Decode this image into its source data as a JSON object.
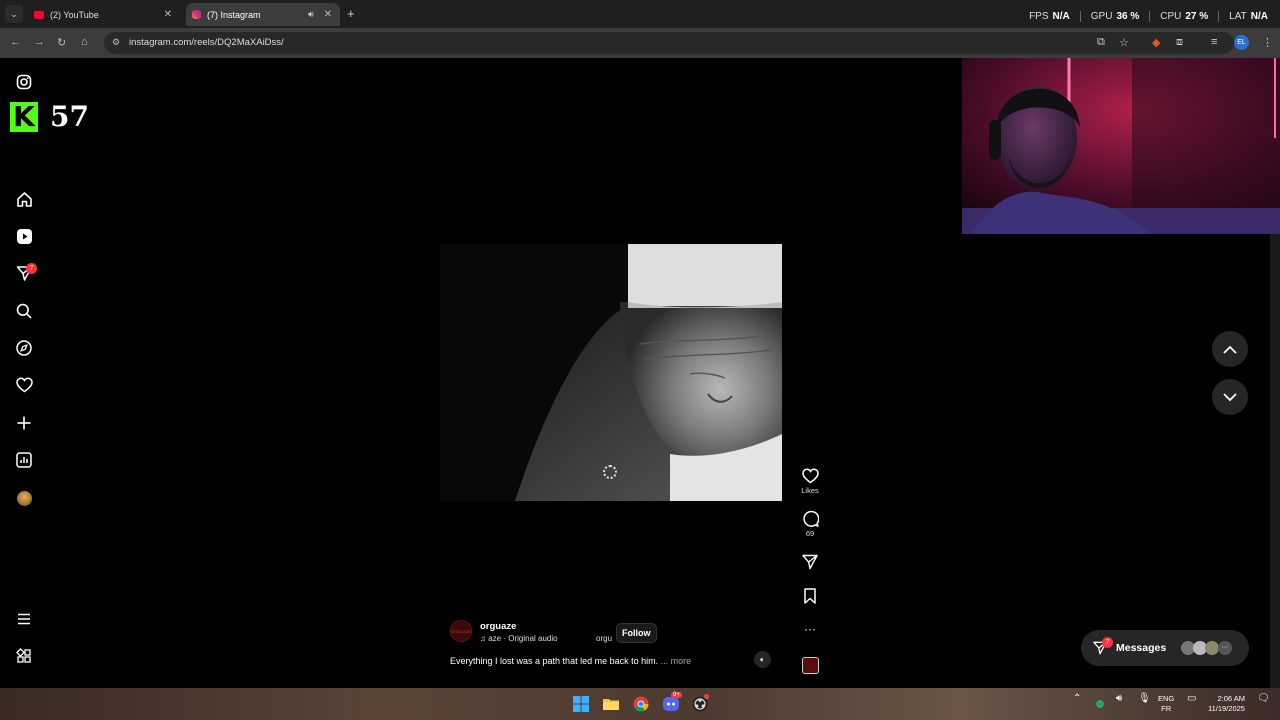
{
  "browser": {
    "tabs": [
      {
        "label": "(2) YouTube",
        "active": false,
        "favicon_color": "#ff0033"
      },
      {
        "label": "(7) Instagram",
        "active": true,
        "favicon_color": "#e1306c"
      }
    ],
    "url": "instagram.com/reels/DQ2MaXAiDss/",
    "profile_initials": "EL"
  },
  "perf_overlay": {
    "fps_label": "FPS",
    "fps_value": "N/A",
    "gpu_label": "GPU",
    "gpu_value": "36 %",
    "cpu_label": "CPU",
    "cpu_value": "27 %",
    "lat_label": "LAT",
    "lat_value": "N/A"
  },
  "sidebar": {
    "overlay_number": "57",
    "notifications_badge": "7"
  },
  "reel": {
    "username": "orguaze",
    "audio": "aze · Original audio",
    "audio_tail": "orgu",
    "follow_label": "Follow",
    "caption": "Everything I lost was a path that led me back to him.",
    "caption_more": "... more",
    "avatar_text": "ORGUAZE"
  },
  "actions": {
    "likes_label": "Likes",
    "comments_count": "69"
  },
  "messages": {
    "label": "Messages",
    "badge": "7"
  },
  "taskbar": {
    "lang_top": "ENG",
    "lang_bottom": "FR",
    "time": "2:06 AM",
    "date": "11/19/2025",
    "discord_badge": "9+"
  },
  "colors": {
    "accent_kick": "#53fc18",
    "badge_red": "#ff3040"
  }
}
